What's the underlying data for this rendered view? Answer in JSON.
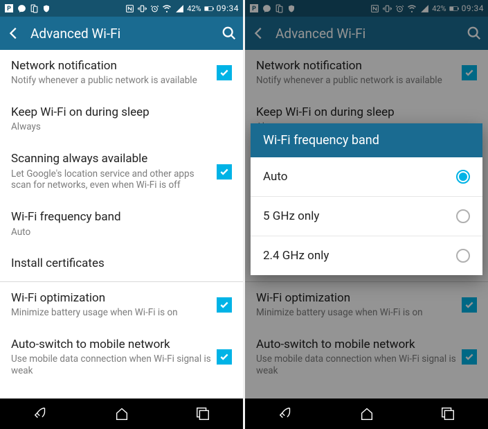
{
  "status": {
    "battery_text": "42%",
    "time": "09:34"
  },
  "header": {
    "title": "Advanced Wi-Fi"
  },
  "settings": {
    "network_notif": {
      "title": "Network notification",
      "sub": "Notify whenever a public network is available"
    },
    "keep_sleep": {
      "title": "Keep Wi-Fi on during sleep",
      "sub": "Always"
    },
    "scan_always": {
      "title": "Scanning always available",
      "sub": "Let Google's location service and other apps scan for networks, even when Wi-Fi is off"
    },
    "freq_band": {
      "title": "Wi-Fi frequency band",
      "sub": "Auto"
    },
    "install_cert": {
      "title": "Install certificates"
    },
    "optimization": {
      "title": "Wi-Fi optimization",
      "sub": "Minimize battery usage when Wi-Fi is on"
    },
    "auto_switch": {
      "title": "Auto-switch to mobile network",
      "sub": "Use mobile data connection when Wi-Fi signal is weak"
    }
  },
  "dialog": {
    "title": "Wi-Fi frequency band",
    "opt_auto": "Auto",
    "opt_5": "5 GHz only",
    "opt_24": "2.4 GHz only"
  }
}
